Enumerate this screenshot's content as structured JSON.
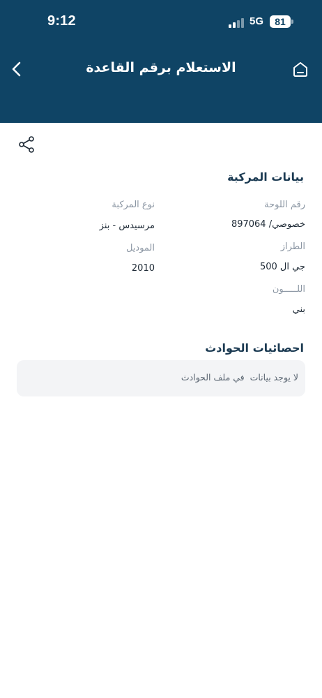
{
  "status_bar": {
    "time": "9:12",
    "network": "5G",
    "battery": "81"
  },
  "header": {
    "title": "الاستعلام برقم القاعدة",
    "back_icon": "chevron-left-icon",
    "home_icon": "home-icon",
    "background": "#0f4465"
  },
  "share": {
    "icon": "share-icon"
  },
  "vehicle": {
    "section_title": "بيانات المركبة",
    "plate_label": "رقم اللوحة",
    "plate_value": "خصوصي/ 897064",
    "type_label": "نوع المركبة",
    "type_value": "مرسيدس - بنز",
    "model_label": "الطراز",
    "model_value": "جي ال 500",
    "year_label": "الموديل",
    "year_value": "2010",
    "color_label": "اللـــــون",
    "color_value": "بني"
  },
  "accidents": {
    "section_title": "احصائيات الحوادث",
    "empty_message": "لا يوجد بيانات  في ملف الحوادث"
  }
}
